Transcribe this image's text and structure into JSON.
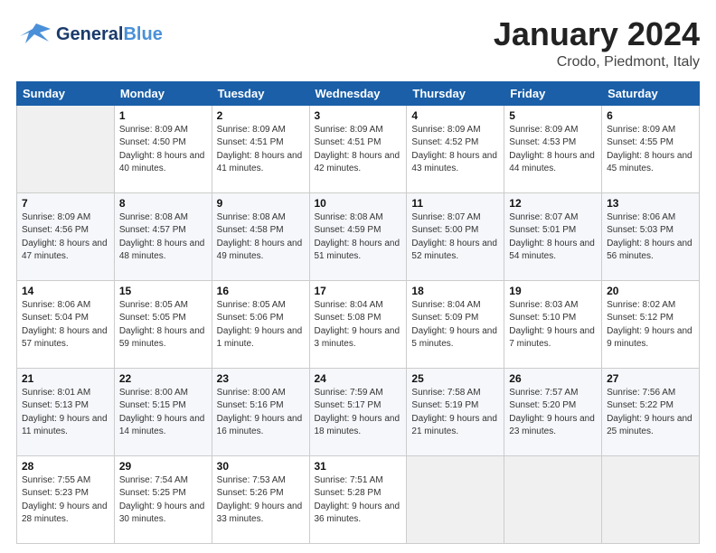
{
  "header": {
    "logo_general": "General",
    "logo_blue": "Blue",
    "month_title": "January 2024",
    "location": "Crodo, Piedmont, Italy"
  },
  "weekdays": [
    "Sunday",
    "Monday",
    "Tuesday",
    "Wednesday",
    "Thursday",
    "Friday",
    "Saturday"
  ],
  "weeks": [
    [
      {
        "num": "",
        "sunrise": "",
        "sunset": "",
        "daylight": ""
      },
      {
        "num": "1",
        "sunrise": "Sunrise: 8:09 AM",
        "sunset": "Sunset: 4:50 PM",
        "daylight": "Daylight: 8 hours and 40 minutes."
      },
      {
        "num": "2",
        "sunrise": "Sunrise: 8:09 AM",
        "sunset": "Sunset: 4:51 PM",
        "daylight": "Daylight: 8 hours and 41 minutes."
      },
      {
        "num": "3",
        "sunrise": "Sunrise: 8:09 AM",
        "sunset": "Sunset: 4:51 PM",
        "daylight": "Daylight: 8 hours and 42 minutes."
      },
      {
        "num": "4",
        "sunrise": "Sunrise: 8:09 AM",
        "sunset": "Sunset: 4:52 PM",
        "daylight": "Daylight: 8 hours and 43 minutes."
      },
      {
        "num": "5",
        "sunrise": "Sunrise: 8:09 AM",
        "sunset": "Sunset: 4:53 PM",
        "daylight": "Daylight: 8 hours and 44 minutes."
      },
      {
        "num": "6",
        "sunrise": "Sunrise: 8:09 AM",
        "sunset": "Sunset: 4:55 PM",
        "daylight": "Daylight: 8 hours and 45 minutes."
      }
    ],
    [
      {
        "num": "7",
        "sunrise": "Sunrise: 8:09 AM",
        "sunset": "Sunset: 4:56 PM",
        "daylight": "Daylight: 8 hours and 47 minutes."
      },
      {
        "num": "8",
        "sunrise": "Sunrise: 8:08 AM",
        "sunset": "Sunset: 4:57 PM",
        "daylight": "Daylight: 8 hours and 48 minutes."
      },
      {
        "num": "9",
        "sunrise": "Sunrise: 8:08 AM",
        "sunset": "Sunset: 4:58 PM",
        "daylight": "Daylight: 8 hours and 49 minutes."
      },
      {
        "num": "10",
        "sunrise": "Sunrise: 8:08 AM",
        "sunset": "Sunset: 4:59 PM",
        "daylight": "Daylight: 8 hours and 51 minutes."
      },
      {
        "num": "11",
        "sunrise": "Sunrise: 8:07 AM",
        "sunset": "Sunset: 5:00 PM",
        "daylight": "Daylight: 8 hours and 52 minutes."
      },
      {
        "num": "12",
        "sunrise": "Sunrise: 8:07 AM",
        "sunset": "Sunset: 5:01 PM",
        "daylight": "Daylight: 8 hours and 54 minutes."
      },
      {
        "num": "13",
        "sunrise": "Sunrise: 8:06 AM",
        "sunset": "Sunset: 5:03 PM",
        "daylight": "Daylight: 8 hours and 56 minutes."
      }
    ],
    [
      {
        "num": "14",
        "sunrise": "Sunrise: 8:06 AM",
        "sunset": "Sunset: 5:04 PM",
        "daylight": "Daylight: 8 hours and 57 minutes."
      },
      {
        "num": "15",
        "sunrise": "Sunrise: 8:05 AM",
        "sunset": "Sunset: 5:05 PM",
        "daylight": "Daylight: 8 hours and 59 minutes."
      },
      {
        "num": "16",
        "sunrise": "Sunrise: 8:05 AM",
        "sunset": "Sunset: 5:06 PM",
        "daylight": "Daylight: 9 hours and 1 minute."
      },
      {
        "num": "17",
        "sunrise": "Sunrise: 8:04 AM",
        "sunset": "Sunset: 5:08 PM",
        "daylight": "Daylight: 9 hours and 3 minutes."
      },
      {
        "num": "18",
        "sunrise": "Sunrise: 8:04 AM",
        "sunset": "Sunset: 5:09 PM",
        "daylight": "Daylight: 9 hours and 5 minutes."
      },
      {
        "num": "19",
        "sunrise": "Sunrise: 8:03 AM",
        "sunset": "Sunset: 5:10 PM",
        "daylight": "Daylight: 9 hours and 7 minutes."
      },
      {
        "num": "20",
        "sunrise": "Sunrise: 8:02 AM",
        "sunset": "Sunset: 5:12 PM",
        "daylight": "Daylight: 9 hours and 9 minutes."
      }
    ],
    [
      {
        "num": "21",
        "sunrise": "Sunrise: 8:01 AM",
        "sunset": "Sunset: 5:13 PM",
        "daylight": "Daylight: 9 hours and 11 minutes."
      },
      {
        "num": "22",
        "sunrise": "Sunrise: 8:00 AM",
        "sunset": "Sunset: 5:15 PM",
        "daylight": "Daylight: 9 hours and 14 minutes."
      },
      {
        "num": "23",
        "sunrise": "Sunrise: 8:00 AM",
        "sunset": "Sunset: 5:16 PM",
        "daylight": "Daylight: 9 hours and 16 minutes."
      },
      {
        "num": "24",
        "sunrise": "Sunrise: 7:59 AM",
        "sunset": "Sunset: 5:17 PM",
        "daylight": "Daylight: 9 hours and 18 minutes."
      },
      {
        "num": "25",
        "sunrise": "Sunrise: 7:58 AM",
        "sunset": "Sunset: 5:19 PM",
        "daylight": "Daylight: 9 hours and 21 minutes."
      },
      {
        "num": "26",
        "sunrise": "Sunrise: 7:57 AM",
        "sunset": "Sunset: 5:20 PM",
        "daylight": "Daylight: 9 hours and 23 minutes."
      },
      {
        "num": "27",
        "sunrise": "Sunrise: 7:56 AM",
        "sunset": "Sunset: 5:22 PM",
        "daylight": "Daylight: 9 hours and 25 minutes."
      }
    ],
    [
      {
        "num": "28",
        "sunrise": "Sunrise: 7:55 AM",
        "sunset": "Sunset: 5:23 PM",
        "daylight": "Daylight: 9 hours and 28 minutes."
      },
      {
        "num": "29",
        "sunrise": "Sunrise: 7:54 AM",
        "sunset": "Sunset: 5:25 PM",
        "daylight": "Daylight: 9 hours and 30 minutes."
      },
      {
        "num": "30",
        "sunrise": "Sunrise: 7:53 AM",
        "sunset": "Sunset: 5:26 PM",
        "daylight": "Daylight: 9 hours and 33 minutes."
      },
      {
        "num": "31",
        "sunrise": "Sunrise: 7:51 AM",
        "sunset": "Sunset: 5:28 PM",
        "daylight": "Daylight: 9 hours and 36 minutes."
      },
      {
        "num": "",
        "sunrise": "",
        "sunset": "",
        "daylight": ""
      },
      {
        "num": "",
        "sunrise": "",
        "sunset": "",
        "daylight": ""
      },
      {
        "num": "",
        "sunrise": "",
        "sunset": "",
        "daylight": ""
      }
    ]
  ]
}
